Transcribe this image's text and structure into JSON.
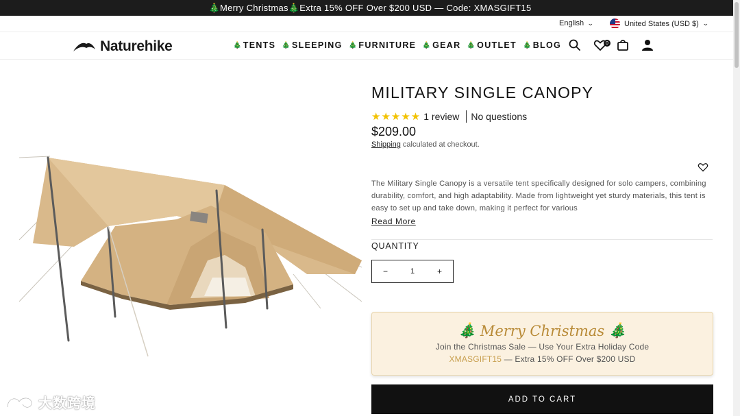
{
  "announcement": "🎄Merry Christmas🎄Extra 15% OFF Over $200 USD — Code: XMASGIFT15",
  "utility": {
    "language": "English",
    "country": "United States (USD $)"
  },
  "header": {
    "brand": "Naturehike",
    "nav": [
      {
        "label": "TENTS"
      },
      {
        "label": "SLEEPING"
      },
      {
        "label": "FURNITURE"
      },
      {
        "label": "GEAR"
      },
      {
        "label": "OUTLET"
      },
      {
        "label": "BLOG"
      }
    ],
    "wishlist_count": "0"
  },
  "product": {
    "title": "MILITARY SINGLE CANOPY",
    "rating_stars": "★★★★★",
    "reviews": "1 review",
    "questions": "No questions",
    "price": "$209.00",
    "shipping_link": "Shipping",
    "shipping_text": " calculated at checkout.",
    "description": "The Military Single Canopy is a versatile tent specifically designed for solo campers, combining durability, comfort, and high adaptability. Made from lightweight yet sturdy materials, this tent is easy to set up and take down, making it perfect for various",
    "read_more": "Read More",
    "quantity_label": "QUANTITY",
    "quantity": "1",
    "minus": "−",
    "plus": "+"
  },
  "promo": {
    "title": "Merry Christmas",
    "tree_left": "🎄",
    "tree_right": "🎄",
    "line1": "Join the Christmas Sale — Use Your Extra Holiday Code",
    "code": "XMASGIFT15",
    "line2_rest": " — Extra 15% OFF Over $200 USD"
  },
  "cart_button": "ADD TO CART",
  "watermark": "大数跨境",
  "colors": {
    "accent_gold": "#b88a36",
    "star": "#f2c200",
    "dark": "#111111"
  }
}
